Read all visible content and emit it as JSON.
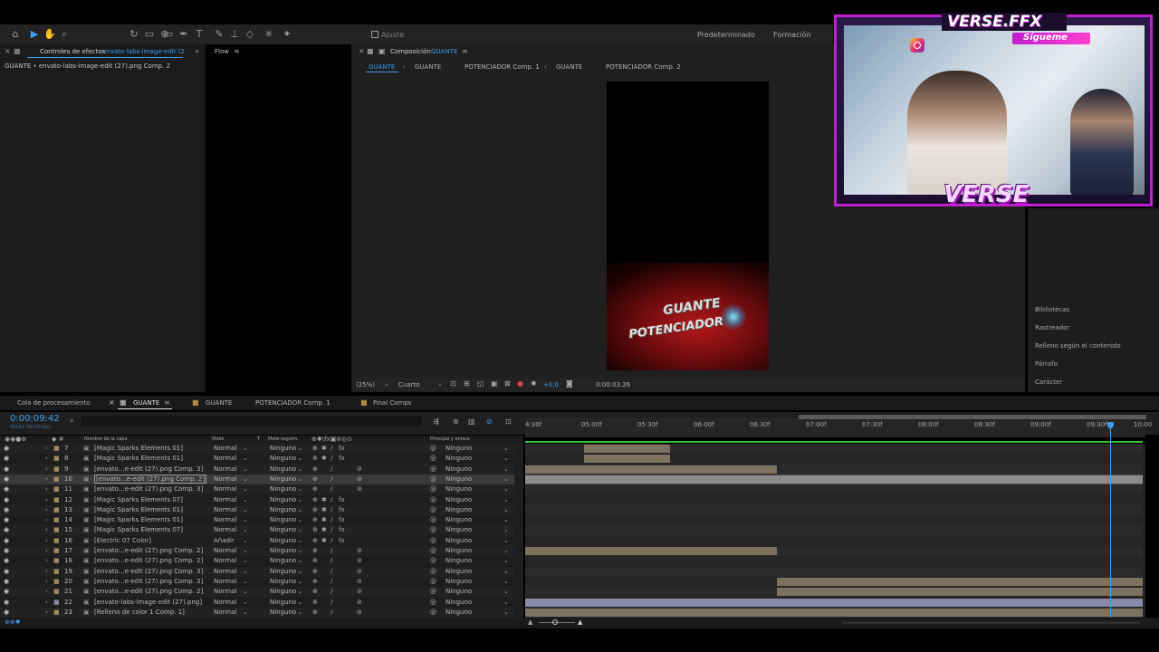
{
  "toolbar": {
    "snap_label": "Ajuste",
    "workspace_default": "Predeterminado",
    "workspace_training": "Formación",
    "icons": [
      "home-icon",
      "selection-icon",
      "hand-icon",
      "zoom-icon",
      "rotate-icon",
      "camera-icon",
      "pan-behind-icon",
      "rectangle-icon",
      "pen-icon",
      "text-icon",
      "brush-icon",
      "clone-stamp-icon",
      "eraser-icon",
      "roto-brush-icon",
      "puppet-pin-icon"
    ]
  },
  "effects_panel": {
    "tab_label": "Controles de efectos",
    "tab_target": "envato-labs-image-edit (2",
    "subtitle": "GUANTE • envato-labs-image-edit (27).png Comp. 2",
    "flow_label": "Flow"
  },
  "composition_panel": {
    "title_prefix": "Composición",
    "title_name": "GUANTE",
    "breadcrumbs": [
      "GUANTE",
      "GUANTE",
      "POTENCIADOR Comp. 1",
      "GUANTE",
      "POTENCIADOR Comp. 2"
    ],
    "zoom": "(25%)",
    "resolution": "Cuarto",
    "exposure": "+0,0",
    "timecode": "0:00:03:26",
    "artwork_line1": "GUANTE",
    "artwork_line2": "POTENCIADOR"
  },
  "webcam": {
    "brand_top": "VERSE.FFX",
    "follow": "Sígueme",
    "brand_bottom": "VERSE"
  },
  "right_panel": {
    "items": [
      "Bibliotecas",
      "Rastreador",
      "Relleno según el contenido",
      "Párrafo",
      "Carácter"
    ]
  },
  "timeline_tabs": [
    "Cola de procesamiento",
    "GUANTE",
    "GUANTE",
    "POTENCIADOR Comp. 1",
    "Final Comps"
  ],
  "timeline": {
    "current_time": "0:00:09:42",
    "frame_info": "00582 (60.00 fps)",
    "headers": {
      "name": "Nombre de la capa",
      "mode": "Modo",
      "t": "T",
      "matte": "Mate seguim.",
      "parent": "Principal y enlace"
    },
    "ruler_ticks": [
      "4:30f",
      "05:00f",
      "05:30f",
      "06:00f",
      "06:30f",
      "07:00f",
      "07:30f",
      "08:00f",
      "08:30f",
      "09:00f",
      "09:30f",
      "10:00"
    ],
    "playhead_time_fraction": 0.947,
    "layers": [
      {
        "num": "7",
        "name": "[Magic Sparks Elements 01]",
        "mode": "Normal",
        "matte": "Ninguno",
        "parent": "Ninguno",
        "fx": true,
        "bar_start": 0.095,
        "bar_end": 0.235
      },
      {
        "num": "8",
        "name": "[Magic Sparks Elements 01]",
        "mode": "Normal",
        "matte": "Ninguno",
        "parent": "Ninguno",
        "fx": true,
        "bar_start": 0.095,
        "bar_end": 0.235
      },
      {
        "num": "9",
        "name": "[envato...e-edit (27).png Comp. 3]",
        "mode": "Normal",
        "matte": "Ninguno",
        "parent": "Ninguno",
        "fx": false,
        "bar_start": 0.0,
        "bar_end": 0.407
      },
      {
        "num": "10",
        "name": "[envato...e-edit (27).png Comp. 2]",
        "mode": "Normal",
        "matte": "Ninguno",
        "parent": "Ninguno",
        "fx": false,
        "bar_start": 0.0,
        "bar_end": 1.0,
        "selected": true
      },
      {
        "num": "11",
        "name": "[envato...e-edit (27).png Comp. 3]",
        "mode": "Normal",
        "matte": "Ninguno",
        "parent": "Ninguno",
        "fx": false,
        "bar_start": 0.0,
        "bar_end": 0.0
      },
      {
        "num": "12",
        "name": "[Magic Sparks Elements 07]",
        "mode": "Normal",
        "matte": "Ninguno",
        "parent": "Ninguno",
        "fx": true,
        "bar_start": 0.0,
        "bar_end": 0.0
      },
      {
        "num": "13",
        "name": "[Magic Sparks Elements 01]",
        "mode": "Normal",
        "matte": "Ninguno",
        "parent": "Ninguno",
        "fx": true,
        "bar_start": 0.0,
        "bar_end": 0.0
      },
      {
        "num": "14",
        "name": "[Magic Sparks Elements 01]",
        "mode": "Normal",
        "matte": "Ninguno",
        "parent": "Ninguno",
        "fx": true,
        "bar_start": 0.0,
        "bar_end": 0.0
      },
      {
        "num": "15",
        "name": "[Magic Sparks Elements 07]",
        "mode": "Normal",
        "matte": "Ninguno",
        "parent": "Ninguno",
        "fx": true,
        "bar_start": 0.0,
        "bar_end": 0.0
      },
      {
        "num": "16",
        "name": "[Electric 07 Color]",
        "mode": "Añadir",
        "matte": "Ninguno",
        "parent": "Ninguno",
        "fx": true,
        "bar_start": 0.0,
        "bar_end": 0.0
      },
      {
        "num": "17",
        "name": "[envato...e-edit (27).png Comp. 2]",
        "mode": "Normal",
        "matte": "Ninguno",
        "parent": "Ninguno",
        "fx": false,
        "bar_start": 0.0,
        "bar_end": 0.407
      },
      {
        "num": "18",
        "name": "[envato...e-edit (27).png Comp. 2]",
        "mode": "Normal",
        "matte": "Ninguno",
        "parent": "Ninguno",
        "fx": false,
        "bar_start": 0.0,
        "bar_end": 0.0
      },
      {
        "num": "19",
        "name": "[envato...e-edit (27).png Comp. 3]",
        "mode": "Normal",
        "matte": "Ninguno",
        "parent": "Ninguno",
        "fx": false,
        "bar_start": 0.0,
        "bar_end": 0.0
      },
      {
        "num": "20",
        "name": "[envato...e-edit (27).png Comp. 3]",
        "mode": "Normal",
        "matte": "Ninguno",
        "parent": "Ninguno",
        "fx": false,
        "bar_start": 0.407,
        "bar_end": 1.0
      },
      {
        "num": "21",
        "name": "[envato...e-edit (27).png Comp. 2]",
        "mode": "Normal",
        "matte": "Ninguno",
        "parent": "Ninguno",
        "fx": false,
        "bar_start": 0.407,
        "bar_end": 1.0
      },
      {
        "num": "22",
        "name": "[envato-labs-image-edit (27).png]",
        "mode": "Normal",
        "matte": "Ninguno",
        "parent": "Ninguno",
        "fx": false,
        "bar_start": 0.0,
        "bar_end": 1.0,
        "footage": true
      },
      {
        "num": "23",
        "name": "[Relleno de color 1 Comp. 1]",
        "mode": "Normal",
        "matte": "Ninguno",
        "parent": "Ninguno",
        "fx": false,
        "bar_start": 0.0,
        "bar_end": 1.0
      }
    ]
  },
  "colors": {
    "accent_blue": "#2d8ceb",
    "track_tan": "#7d725f",
    "track_footage": "#8a88a8",
    "work_area_green": "#35c235",
    "brand_magenta": "#d21ad8"
  }
}
